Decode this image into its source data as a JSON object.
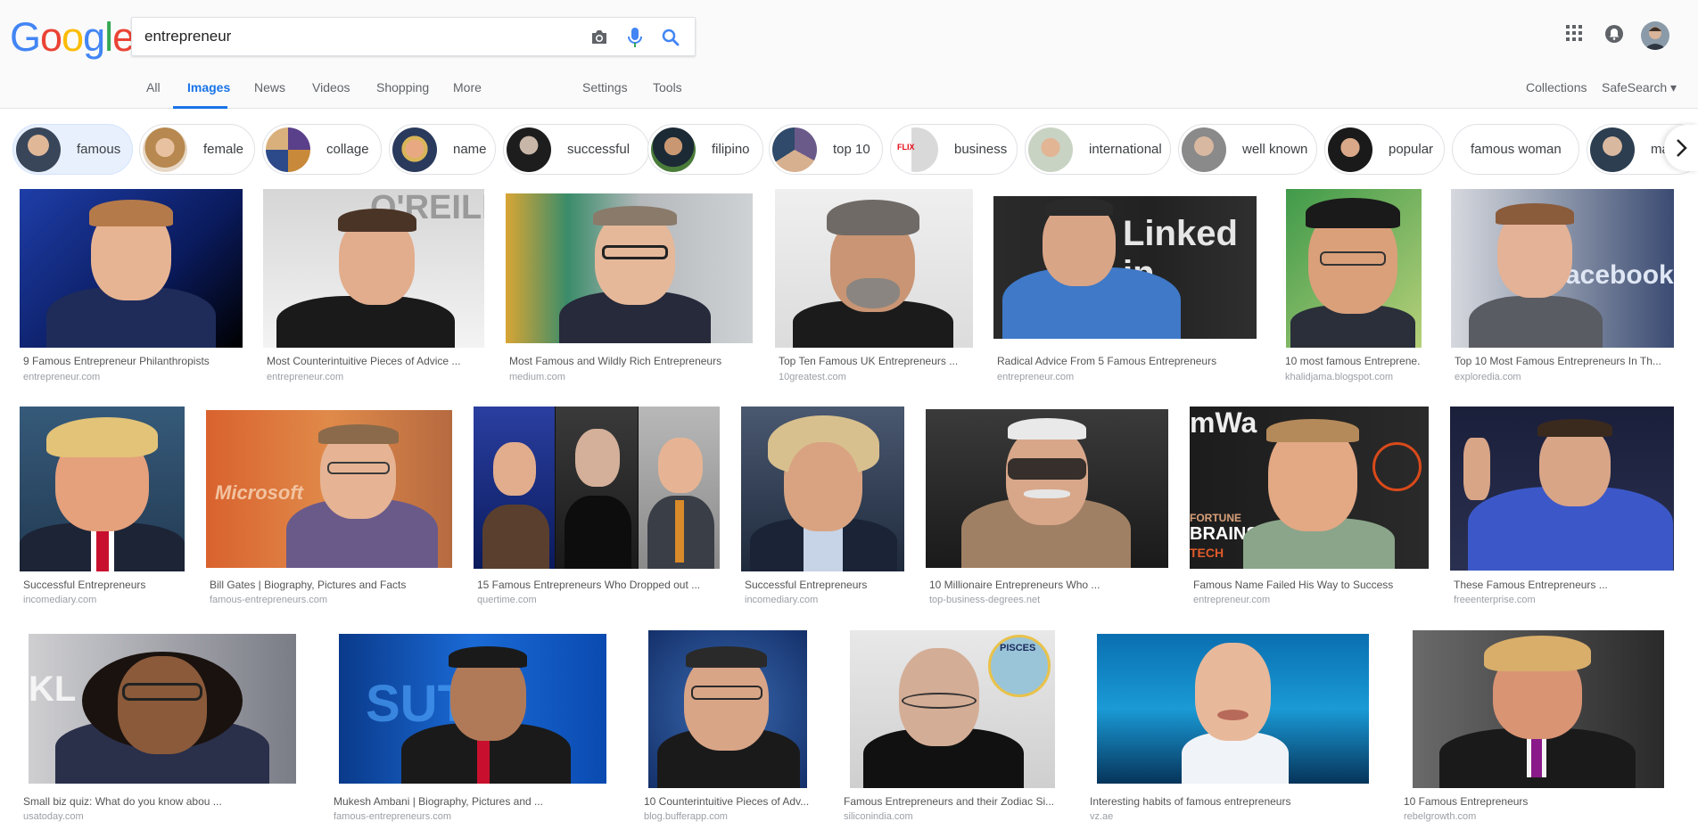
{
  "logo": {
    "letters": [
      "G",
      "o",
      "o",
      "g",
      "l",
      "e"
    ],
    "colors": [
      "#4285F4",
      "#EA4335",
      "#FBBC05",
      "#4285F4",
      "#34A853",
      "#EA4335"
    ]
  },
  "search": {
    "query": "entrepreneur"
  },
  "nav": {
    "items": [
      "All",
      "Images",
      "News",
      "Videos",
      "Shopping",
      "More"
    ],
    "settings": "Settings",
    "tools": "Tools",
    "collections": "Collections",
    "safesearch": "SafeSearch ▾",
    "active": "Images"
  },
  "chips": [
    {
      "label": "famous",
      "active": true
    },
    {
      "label": "female"
    },
    {
      "label": "collage"
    },
    {
      "label": "name"
    },
    {
      "label": "successful"
    },
    {
      "label": "filipino"
    },
    {
      "label": "top 10"
    },
    {
      "label": "business"
    },
    {
      "label": "international"
    },
    {
      "label": "well known"
    },
    {
      "label": "popular"
    },
    {
      "label": "famous woman"
    },
    {
      "label": "male"
    }
  ],
  "results": [
    {
      "caption": "9 Famous Entrepreneur Philanthropists",
      "source": "entrepreneur.com"
    },
    {
      "caption": "Most Counterintuitive Pieces of Advice ...",
      "source": "entrepreneur.com"
    },
    {
      "caption": "Most Famous and Wildly Rich Entrepreneurs",
      "source": "medium.com"
    },
    {
      "caption": "Top Ten Famous UK Entrepreneurs ...",
      "source": "10greatest.com"
    },
    {
      "caption": "Radical Advice From 5 Famous Entrepreneurs",
      "source": "entrepreneur.com"
    },
    {
      "caption": "10 most famous Entreprene...",
      "source": "khalidjama.blogspot.com"
    },
    {
      "caption": "Top 10 Most Famous Entrepreneurs In Th...",
      "source": "exploredia.com"
    },
    {
      "caption": "Successful Entrepreneurs",
      "source": "incomediary.com"
    },
    {
      "caption": "Bill Gates | Biography, Pictures and Facts",
      "source": "famous-entrepreneurs.com"
    },
    {
      "caption": "15 Famous Entrepreneurs Who Dropped out ...",
      "source": "quertime.com"
    },
    {
      "caption": "Successful Entrepreneurs",
      "source": "incomediary.com"
    },
    {
      "caption": "10 Millionaire Entrepreneurs Who ...",
      "source": "top-business-degrees.net"
    },
    {
      "caption": "Famous Name Failed His Way to Success",
      "source": "entrepreneur.com"
    },
    {
      "caption": "These Famous Entrepreneurs ...",
      "source": "freeenterprise.com"
    },
    {
      "caption": "Small biz quiz: What do you know abou ...",
      "source": "usatoday.com"
    },
    {
      "caption": "Mukesh Ambani | Biography, Pictures and ...",
      "source": "famous-entrepreneurs.com"
    },
    {
      "caption": "10 Counterintuitive Pieces of Adv...",
      "source": "blog.bufferapp.com"
    },
    {
      "caption": "Famous Entrepreneurs and their Zodiac Si...",
      "source": "siliconindia.com"
    },
    {
      "caption": "Interesting habits of famous entrepreneurs",
      "source": "vz.ae"
    },
    {
      "caption": "10 Famous Entrepreneurs",
      "source": "rebelgrowth.com"
    }
  ],
  "image_text": {
    "linkedin": "Linked in",
    "facebook": "facebook",
    "fortune": "FORTUNE",
    "brainstorm": "BRAINSTO",
    "tech": "TECH",
    "pisces": "PISCES",
    "oreilly": "O'REILLY"
  }
}
